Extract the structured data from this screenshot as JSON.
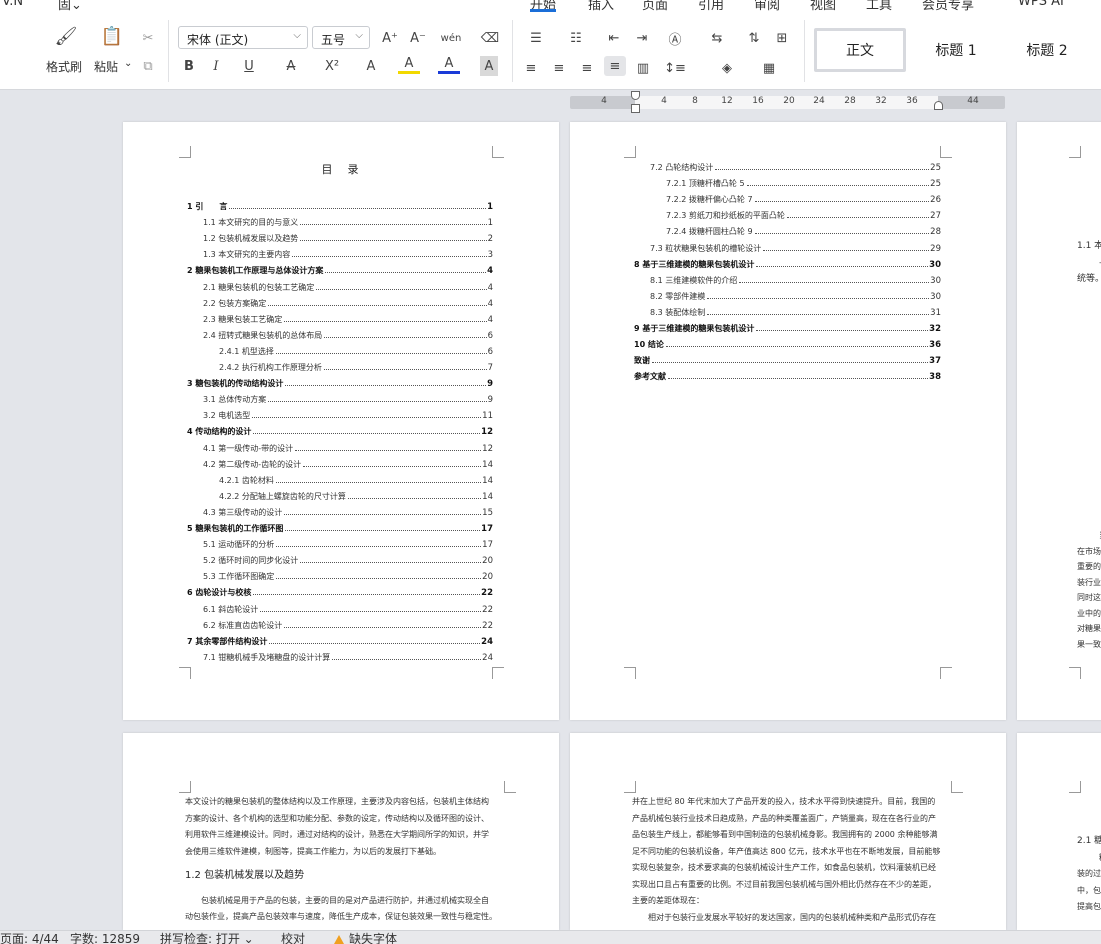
{
  "menu": {
    "left_partial": [
      "V.N",
      "固⌄",
      "⇝",
      "⌄",
      "|"
    ],
    "tabs": [
      "开始",
      "插入",
      "页面",
      "引用",
      "审阅",
      "视图",
      "工具",
      "会员专享"
    ],
    "active_tab": "开始",
    "right_label": "WPS AI"
  },
  "ribbon": {
    "format_painter": "格式刷",
    "paste": "粘贴",
    "font_name": "宋体 (正文)",
    "font_size": "五号",
    "styles": [
      "正文",
      "标题 1",
      "标题 2"
    ],
    "grow_font": "A⁺",
    "shrink_font": "A⁻",
    "pinyin": "wén",
    "bold": "B",
    "italic": "I",
    "underline": "U",
    "strike": "A",
    "superscript": "X²",
    "text_effect": "A",
    "highlight": "A",
    "font_color": "A",
    "char_shade": "A"
  },
  "ruler": {
    "ticks": [
      "4",
      "4",
      "8",
      "12",
      "16",
      "20",
      "24",
      "28",
      "32",
      "36",
      "44"
    ]
  },
  "page1": {
    "title": "目　录",
    "toc": [
      {
        "label": "1  引　　言",
        "page": "1",
        "level": 1
      },
      {
        "label": "1.1  本文研究的目的与意义",
        "page": "1",
        "level": 2
      },
      {
        "label": "1.2  包装机械发展以及趋势",
        "page": "2",
        "level": 2
      },
      {
        "label": "1.3  本文研究的主要内容",
        "page": "3",
        "level": 2
      },
      {
        "label": "2  糖果包装机工作原理与总体设计方案",
        "page": "4",
        "level": 1
      },
      {
        "label": "2.1  糖果包装机的包装工艺确定",
        "page": "4",
        "level": 2
      },
      {
        "label": "2.2  包装方案确定",
        "page": "4",
        "level": 2
      },
      {
        "label": "2.3  糖果包装工艺确定",
        "page": "4",
        "level": 2
      },
      {
        "label": "2.4  扭转式糖果包装机的总体布局",
        "page": "6",
        "level": 2
      },
      {
        "label": "2.4.1  机型选择",
        "page": "6",
        "level": 3
      },
      {
        "label": "2.4.2  执行机构工作原理分析",
        "page": "7",
        "level": 3
      },
      {
        "label": "3  糖包装机的传动结构设计",
        "page": "9",
        "level": 1
      },
      {
        "label": "3.1  总体传动方案",
        "page": "9",
        "level": 2
      },
      {
        "label": "3.2  电机选型",
        "page": "11",
        "level": 2
      },
      {
        "label": "4  传动结构的设计",
        "page": "12",
        "level": 1
      },
      {
        "label": "4.1  第一级传动-带的设计",
        "page": "12",
        "level": 2
      },
      {
        "label": "4.2  第二级传动-齿轮的设计",
        "page": "14",
        "level": 2
      },
      {
        "label": "4.2.1  齿轮材料",
        "page": "14",
        "level": 3
      },
      {
        "label": "4.2.2  分配轴上螺旋齿轮的尺寸计算",
        "page": "14",
        "level": 3
      },
      {
        "label": "4.3  第三级传动的设计",
        "page": "15",
        "level": 2
      },
      {
        "label": "5  糖果包装机的工作循环图",
        "page": "17",
        "level": 1
      },
      {
        "label": "5.1  运动循环的分析",
        "page": "17",
        "level": 2
      },
      {
        "label": "5.2  循环时间的同步化设计",
        "page": "20",
        "level": 2
      },
      {
        "label": "5.3  工作循环图确定",
        "page": "20",
        "level": 2
      },
      {
        "label": "6  齿轮设计与校核",
        "page": "22",
        "level": 1
      },
      {
        "label": "6.1  斜齿轮设计",
        "page": "22",
        "level": 2
      },
      {
        "label": "6.2  标准直齿齿轮设计",
        "page": "22",
        "level": 2
      },
      {
        "label": "7  其余零部件结构设计",
        "page": "24",
        "level": 1
      },
      {
        "label": "7.1  钳糖机械手及堵糖盘的设计计算",
        "page": "24",
        "level": 2
      }
    ]
  },
  "page2": {
    "toc": [
      {
        "label": "7.2  凸轮结构设计",
        "page": "25",
        "level": 2
      },
      {
        "label": "7.2.1  顶糖杆槽凸轮 5",
        "page": "25",
        "level": 3
      },
      {
        "label": "7.2.2  拨糖杆偏心凸轮 7",
        "page": "26",
        "level": 3
      },
      {
        "label": "7.2.3  剪纸刀和抄纸板的平面凸轮",
        "page": "27",
        "level": 3
      },
      {
        "label": "7.2.4  拨糖杆圆柱凸轮 9",
        "page": "28",
        "level": 3
      },
      {
        "label": "7.3  粒状糖果包装机的槽轮设计",
        "page": "29",
        "level": 2
      },
      {
        "label": "8  基于三维建模的糖果包装机设计",
        "page": "30",
        "level": 1
      },
      {
        "label": "8.1  三维建模软件的介绍",
        "page": "30",
        "level": 2
      },
      {
        "label": "8.2  零部件建模",
        "page": "30",
        "level": 2
      },
      {
        "label": "8.3  装配体绘制",
        "page": "31",
        "level": 2
      },
      {
        "label": "9  基于三维建模的糖果包装机设计",
        "page": "32",
        "level": 1
      },
      {
        "label": "10  结论",
        "page": "36",
        "level": 1
      },
      {
        "label": "致谢",
        "page": "37",
        "level": 1
      },
      {
        "label": "参考文献",
        "page": "38",
        "level": 1
      }
    ]
  },
  "page3": {
    "lines": [
      "本文设计的糖果包装机的整体结构以及工作原理，主要涉及内容包括，包装机主体结构",
      "方案的设计、各个机构的选型和功能分配、参数的设定，传动结构以及循环图的设计、",
      "利用软件三维建模设计。同时，通过对结构的设计，熟悉在大学期间所学的知识，并学",
      "会使用三维软件建模，制图等，提高工作能力，为以后的发展打下基础。"
    ],
    "heading": "1.2  包装机械发展以及趋势",
    "lines2": [
      "　　包装机械是用于产品的包装，主要的目的是对产品进行防护，并通过机械实现全自",
      "动包装作业，提高产品包装效率与速度，降低生产成本，保证包装效果一致性与稳定性。"
    ]
  },
  "page4": {
    "lines": [
      "并在上世纪 80 年代末加大了产品开发的投入，技术水平得到快速提升。目前，我国的",
      "产品机械包装行业技术日趋成熟，产品的种类覆盖面广，产销量高，现在在各行业的产",
      "品包装生产线上，都能够看到中国制造的包装机械身影。我国拥有的 2000 余种能够满",
      "足不同功能的包装机设备，年产值高达 800 亿元，技术水平也在不断地发展，目前能够",
      "实现包装复杂，技术要求高的包装机械设计生产工作，如食品包装机，饮料灌装机已经",
      "实现出口且占有重要的比例。不过目前我国包装机械与国外相比仍然存在不少的差距，",
      "主要的差距体现在：",
      "　　相对于包装行业发展水平较好的发达国家，国内的包装机械种类和产品形式仍存在"
    ]
  },
  "edge_page_top": {
    "lines": [
      "1.1  本",
      "—",
      "统等。"
    ]
  },
  "edge_page_mid": {
    "lines": [
      "当",
      "在市场",
      "重要的",
      "装行业",
      "同时这",
      "业中的",
      "对糖果",
      "果一致"
    ]
  },
  "edge_page_bottom": {
    "lines": [
      "2.1  糖",
      "糖",
      "装的过",
      "中，包",
      "提高包"
    ]
  },
  "status": {
    "page": "页面: 4/44",
    "words": "字数: 12859",
    "spell": "拼写检查: 打开 ⌄",
    "proof": "校对",
    "missing_font": "缺失字体"
  }
}
